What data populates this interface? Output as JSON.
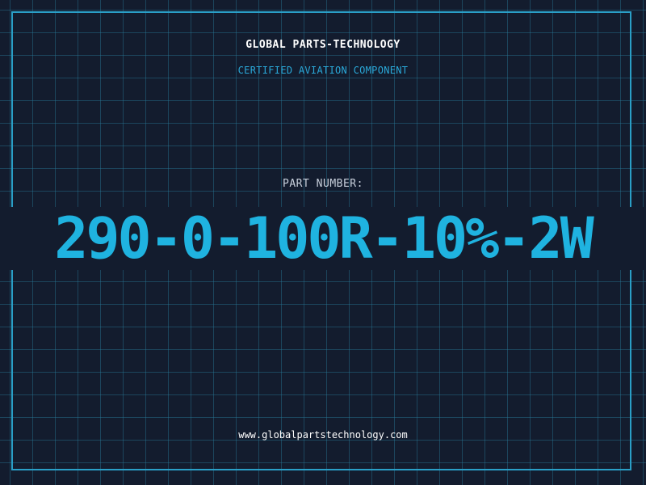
{
  "brand": "GLOBAL PARTS-TECHNOLOGY",
  "subtitle": "CERTIFIED AVIATION COMPONENT",
  "part_label": "PART NUMBER:",
  "part_number": "290-0-100R-10%-2W",
  "website": "www.globalpartstechnology.com",
  "colors": {
    "background": "#131c2e",
    "grid": "#287896",
    "frame": "#2a9fc7",
    "accent": "#1fb3e0"
  }
}
